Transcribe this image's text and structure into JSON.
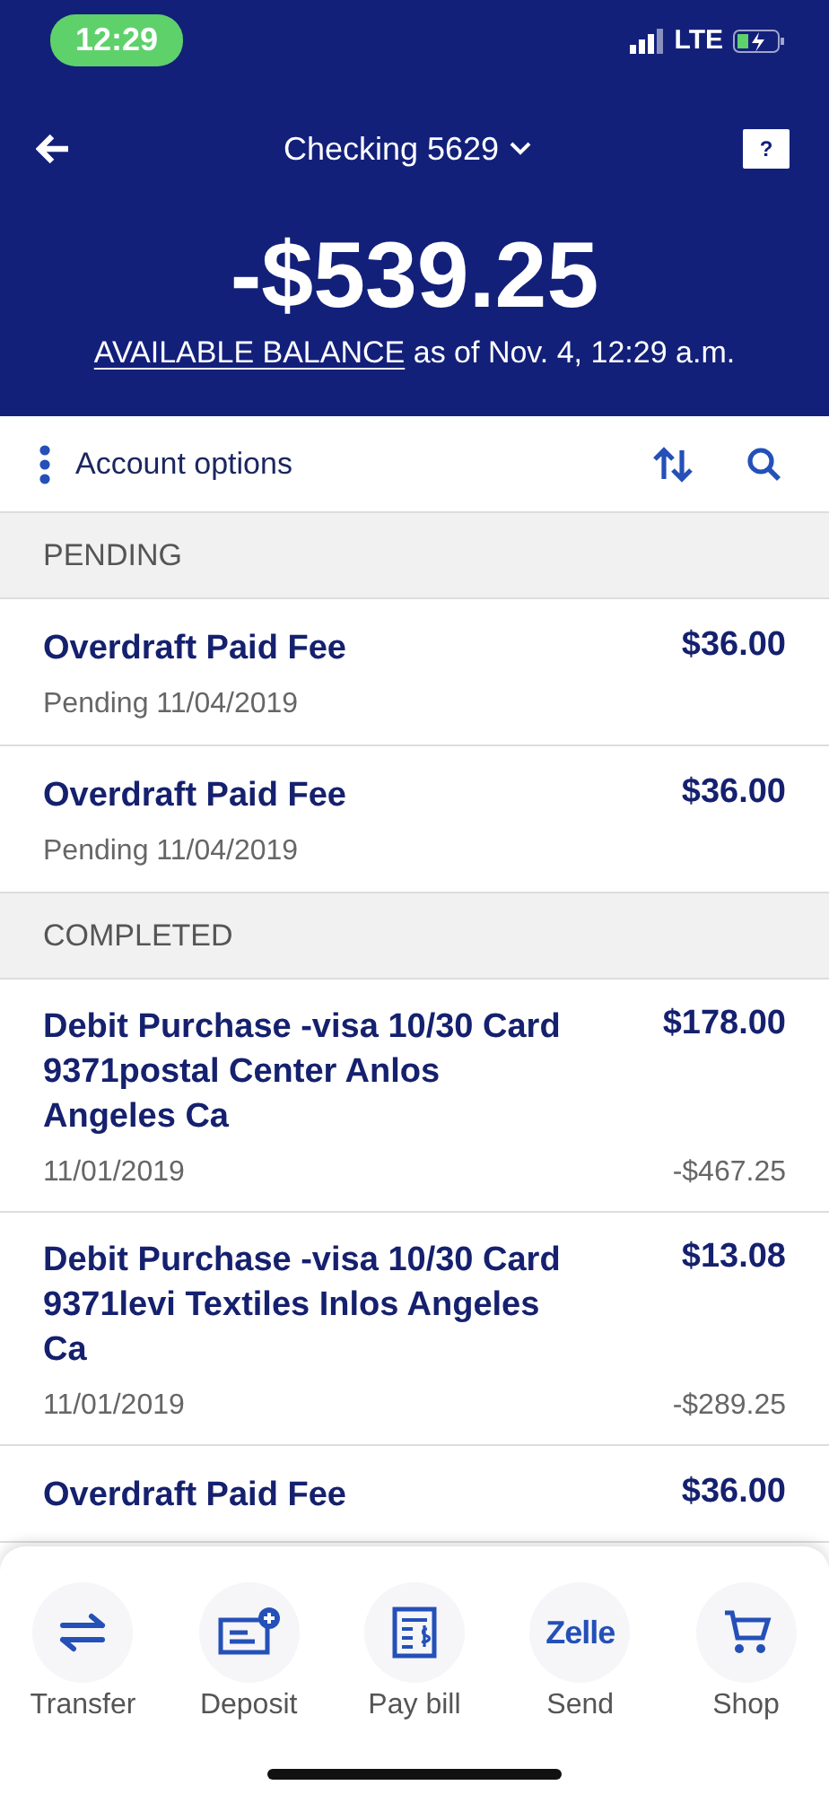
{
  "status_bar": {
    "time": "12:29",
    "network": "LTE"
  },
  "header": {
    "account": "Checking 5629",
    "help": "?",
    "balance": "-$539.25",
    "balance_label": "AVAILABLE BALANCE",
    "as_of": "as of Nov. 4, 12:29 a.m."
  },
  "toolbar": {
    "label": "Account options"
  },
  "sections": [
    {
      "title": "PENDING",
      "transactions": [
        {
          "kind": "pending",
          "description": "Overdraft Paid Fee",
          "amount": "$36.00",
          "detail": "Pending 11/04/2019"
        },
        {
          "kind": "pending",
          "description": "Overdraft Paid Fee",
          "amount": "$36.00",
          "detail": "Pending 11/04/2019"
        }
      ]
    },
    {
      "title": "COMPLETED",
      "transactions": [
        {
          "kind": "completed",
          "description": "Debit Purchase -visa 10/30 Card 9371postal Center Anlos Angeles Ca",
          "amount": "$178.00",
          "detail": "11/01/2019",
          "balance": "-$467.25"
        },
        {
          "kind": "completed",
          "description": "Debit Purchase -visa 10/30 Card 9371levi Textiles Inlos Angeles Ca",
          "amount": "$13.08",
          "detail": "11/01/2019",
          "balance": "-$289.25"
        },
        {
          "kind": "cut",
          "description": "Overdraft Paid Fee",
          "amount": "$36.00"
        }
      ]
    }
  ],
  "bottom_nav": [
    {
      "kind": "transfer",
      "label": "Transfer"
    },
    {
      "kind": "deposit",
      "label": "Deposit"
    },
    {
      "kind": "paybill",
      "label": "Pay bill"
    },
    {
      "kind": "zelle",
      "label": "Send",
      "logo": "Zelle"
    },
    {
      "kind": "shop",
      "label": "Shop"
    }
  ]
}
